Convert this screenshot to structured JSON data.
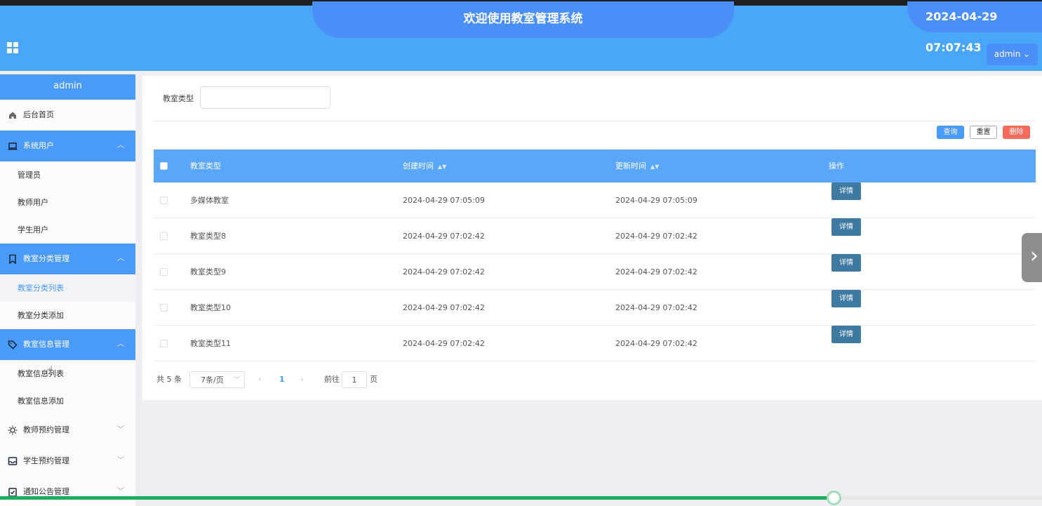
{
  "header": {
    "title": "欢迎使用教室管理系统",
    "datetime": "2024-04-29 07:07:43",
    "user_button": "admin ⌄"
  },
  "sidebar": {
    "user": "admin",
    "home": "后台首页",
    "groups": [
      {
        "label": "系统用户",
        "items": [
          "管理员",
          "教师用户",
          "学生用户"
        ]
      },
      {
        "label": "教室分类管理",
        "items": [
          "教室分类列表",
          "教室分类添加"
        ]
      },
      {
        "label": "教室信息管理",
        "items": [
          "教室信息列表",
          "教室信息添加"
        ]
      },
      {
        "label": "教师预约管理"
      },
      {
        "label": "学生预约管理"
      },
      {
        "label": "通知公告管理"
      }
    ]
  },
  "search": {
    "label": "教室类型",
    "value": ""
  },
  "actions": {
    "query": "查询",
    "reset": "重置",
    "delete": "删除"
  },
  "table": {
    "headers": [
      "教室类型",
      "创建时间",
      "更新时间",
      "操作"
    ],
    "detail_label": "详情",
    "rows": [
      {
        "type": "多媒体教室",
        "created": "2024-04-29 07:05:09",
        "updated": "2024-04-29 07:05:09"
      },
      {
        "type": "教室类型8",
        "created": "2024-04-29 07:02:42",
        "updated": "2024-04-29 07:02:42"
      },
      {
        "type": "教室类型9",
        "created": "2024-04-29 07:02:42",
        "updated": "2024-04-29 07:02:42"
      },
      {
        "type": "教室类型10",
        "created": "2024-04-29 07:02:42",
        "updated": "2024-04-29 07:02:42"
      },
      {
        "type": "教室类型11",
        "created": "2024-04-29 07:02:42",
        "updated": "2024-04-29 07:02:42"
      }
    ]
  },
  "pagination": {
    "total": "共 5 条",
    "page_size": "7条/页",
    "current_page": "1",
    "goto_label": "前往",
    "goto_value": "1",
    "page_unit": "页"
  },
  "playback": {
    "progress": 0.8
  },
  "colors": {
    "primary": "#4a9af8",
    "header": "#4aa6f9",
    "danger": "#f56c5c",
    "detail": "#3f7aa3"
  }
}
